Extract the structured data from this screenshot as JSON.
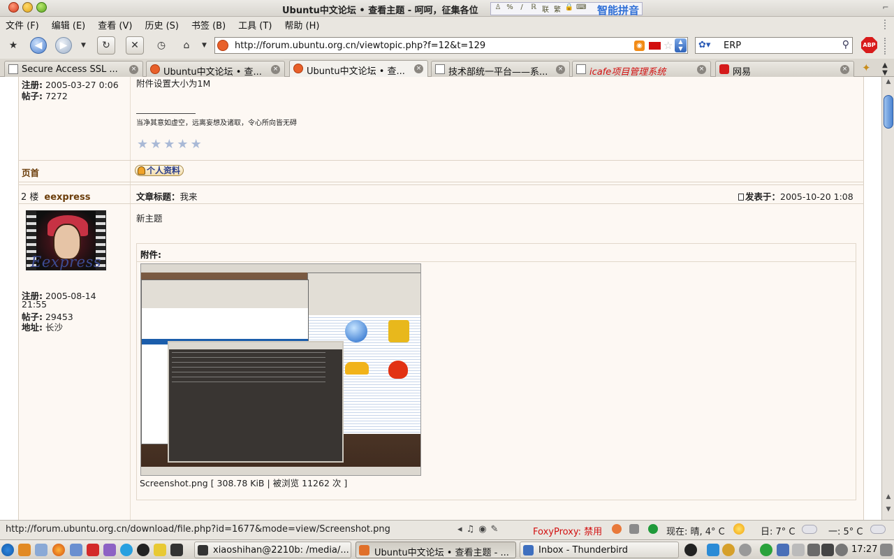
{
  "window": {
    "title": "Ubuntu中文论坛 • 查看主题 - 呵呵，征集各位",
    "ime_name": "智能拼音",
    "ime_icons": [
      "♙",
      "%",
      "/",
      "ℝ",
      "联",
      "繁",
      "🔒",
      "⌨"
    ]
  },
  "menu": {
    "items": [
      "文件 (F)",
      "编辑 (E)",
      "查看 (V)",
      "历史 (S)",
      "书签 (B)",
      "工具 (T)",
      "帮助 (H)"
    ]
  },
  "navbar": {
    "url": "http://forum.ubuntu.org.cn/viewtopic.php?f=12&t=129",
    "search_value": "ERP",
    "abp_label": "ABP"
  },
  "tabs": [
    {
      "label": "Secure Access SSL ...",
      "icon": "page",
      "active": false
    },
    {
      "label": "Ubuntu中文论坛 • 查...",
      "icon": "ubuntu",
      "active": false
    },
    {
      "label": "Ubuntu中文论坛 • 查...",
      "icon": "ubuntu",
      "active": true
    },
    {
      "label": "技术部统一平台——系...",
      "icon": "page",
      "active": false
    },
    {
      "label": "icafe项目管理系统",
      "icon": "page",
      "active": false
    },
    {
      "label": "网易",
      "icon": "netease",
      "active": false
    }
  ],
  "post1": {
    "reg_label": "注册:",
    "reg_value": "2005-03-27 0:06",
    "posts_label": "帖子:",
    "posts_value": "7272",
    "body_line": "附件设置大小为1M",
    "signature": "当净其意如虚空，远离妄想及诸取，令心所向皆无碍",
    "top_link": "页首",
    "profile_button": "个人资料",
    "rating": "5"
  },
  "post2": {
    "floor": "2 楼",
    "username": "eexpress",
    "avatar_text": "Eexpress",
    "subject_label": "文章标题：",
    "subject": "我来",
    "posted_label": "发表于：",
    "posted_value": "2005-10-20 1:08",
    "body": "新主题",
    "attachment_title": "附件:",
    "attachment_caption": "Screenshot.png [ 308.78 KiB | 被浏览 11262 次 ]",
    "reg_label": "注册:",
    "reg_value": "2005-08-14",
    "reg_time": "21:55",
    "posts_label": "帖子:",
    "posts_value": "29453",
    "location_label": "地址:",
    "location_value": "长沙"
  },
  "status": {
    "url": "http://forum.ubuntu.org.cn/download/file.php?id=1677&mode=view/Screenshot.png",
    "foxyproxy": "FoxyProxy: 禁用",
    "weather_now": "现在: 晴, 4° C",
    "weather_day": "日: 7° C",
    "weather_night": "一: 5° C"
  },
  "taskbar": {
    "tasks": [
      {
        "label": "xiaoshihan@2210b: /media/...",
        "active": false
      },
      {
        "label": "Ubuntu中文论坛 • 查看主题 - ...",
        "active": true
      },
      {
        "label": "Inbox - Thunderbird",
        "active": false
      }
    ],
    "clock": "17:27"
  },
  "colors": {
    "accent_blue": "#2f6fd6",
    "user_brown": "#6b3d0a",
    "foxy_red": "#d21010",
    "panel_bg": "#fdf8f3"
  }
}
